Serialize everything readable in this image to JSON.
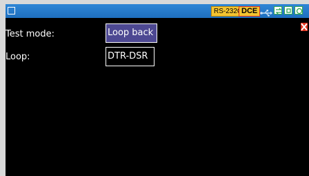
{
  "status_bar": {
    "interface_badge": "RS-232C",
    "mode_badge": "DCE",
    "usb_icon": "usb-icon",
    "icons": [
      "connect-icon",
      "screen-icon",
      "clock-icon"
    ]
  },
  "settings": {
    "test_mode": {
      "label": "Test mode:",
      "value": "Loop back"
    },
    "loop": {
      "label": "Loop:",
      "value": "DTR-DSR"
    }
  },
  "colors": {
    "title_bar": "#1e6fbe",
    "badge_fill": "#f3c431",
    "selected_field": "#4d4892",
    "close_button": "#e0341f",
    "background": "#000000"
  }
}
